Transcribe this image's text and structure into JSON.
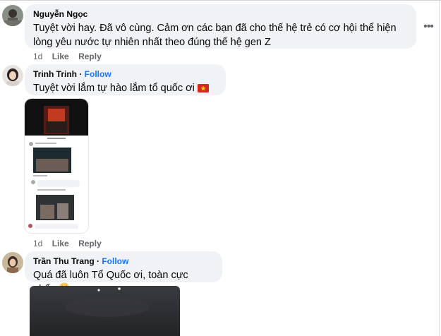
{
  "comments": [
    {
      "author": "Nguyễn Ngọc",
      "follow": "",
      "text": "Tuyệt vời hay. Đã vô cùng. Cảm ơn các bạn đã cho thế hệ trẻ có cơ hội thể hiện lòng yêu nước tự nhiên nhất theo đúng thế hệ gen Z",
      "time": "1d",
      "like": "Like",
      "reply": "Reply"
    },
    {
      "author": "Trinh Trinh",
      "follow": "Follow",
      "text": "Tuyệt vời lắm tự hào lắm tổ quốc ơi",
      "time": "1d",
      "like": "Like",
      "reply": "Reply"
    },
    {
      "author": "Trần Thu Trang",
      "follow": "Follow",
      "text": "Quá đã luôn Tổ Quốc ơi, toàn cực phẩm"
    }
  ],
  "separator": " · ",
  "icons": {
    "more": "more-horizontal-icon",
    "vn_flag": "vietnam-flag-emoji",
    "heart": "red-heart-emoji",
    "star_eyes": "star-struck-emoji"
  },
  "colors": {
    "bubble": "#f0f2f5",
    "follow": "#1877f2",
    "meta": "#65676b"
  }
}
